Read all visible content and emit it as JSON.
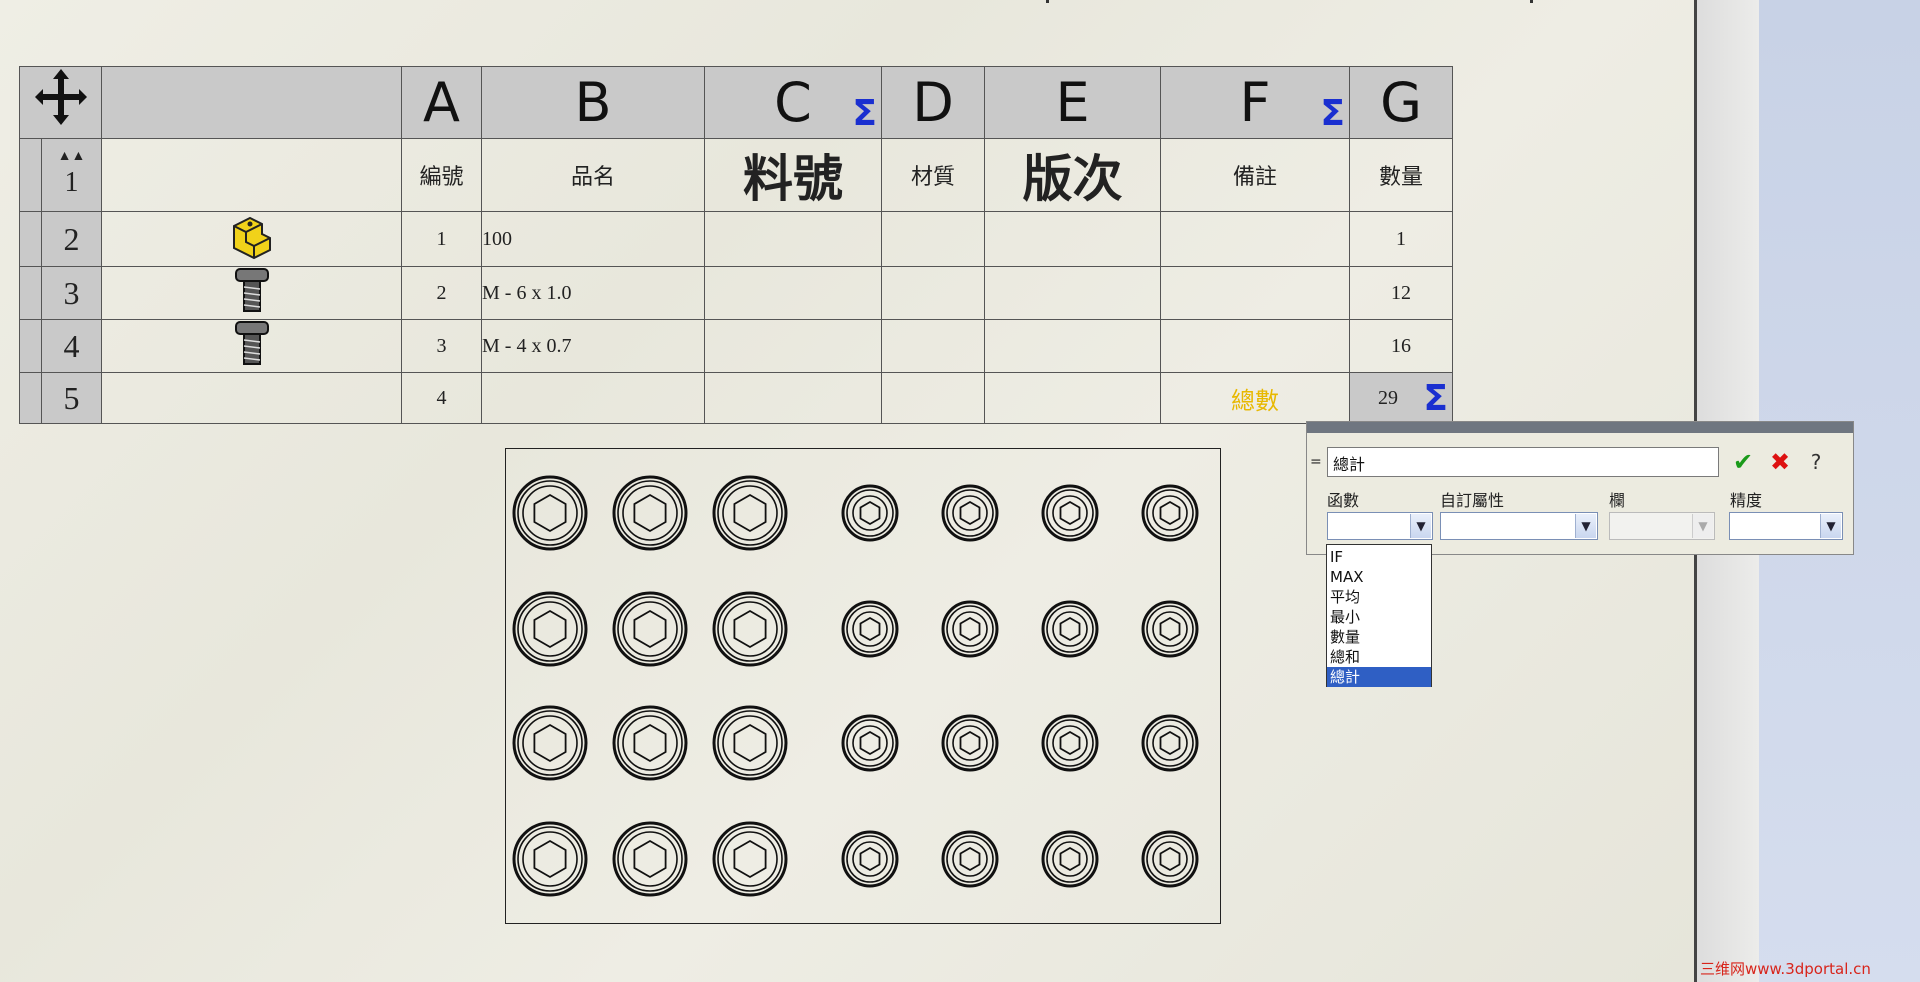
{
  "table": {
    "columns": [
      "A",
      "B",
      "C",
      "D",
      "E",
      "F",
      "G"
    ],
    "header_row_number": "1",
    "headers": [
      "編號",
      "品名",
      "料號",
      "材質",
      "版次",
      "備註",
      "數量"
    ],
    "rows": [
      {
        "row": "2",
        "a": "1",
        "b": "100",
        "c": "",
        "d": "",
        "e": "",
        "f": "",
        "g": "1",
        "icon": "part-icon"
      },
      {
        "row": "3",
        "a": "2",
        "b": "M - 6 x 1.0",
        "c": "",
        "d": "",
        "e": "",
        "f": "",
        "g": "12",
        "icon": "bolt-icon"
      },
      {
        "row": "4",
        "a": "3",
        "b": "M - 4 x 0.7",
        "c": "",
        "d": "",
        "e": "",
        "f": "",
        "g": "16",
        "icon": "bolt-icon"
      },
      {
        "row": "5",
        "a": "4",
        "b": "",
        "c": "",
        "d": "",
        "e": "",
        "f": "總數",
        "g": "29",
        "icon": ""
      }
    ],
    "accent_sigma_color": "#1a2fd0",
    "total_label_color": "#e8b800"
  },
  "dialog": {
    "eq_sign": "=",
    "formula": "總計",
    "labels": {
      "function": "函數",
      "custom_property": "自訂屬性",
      "column": "欄",
      "precision": "精度"
    },
    "function_options": [
      "IF",
      "MAX",
      "平均",
      "最小",
      "數量",
      "總和",
      "總計"
    ],
    "selected_function": "總計"
  },
  "watermark": "三维网www.3dportal.cn"
}
